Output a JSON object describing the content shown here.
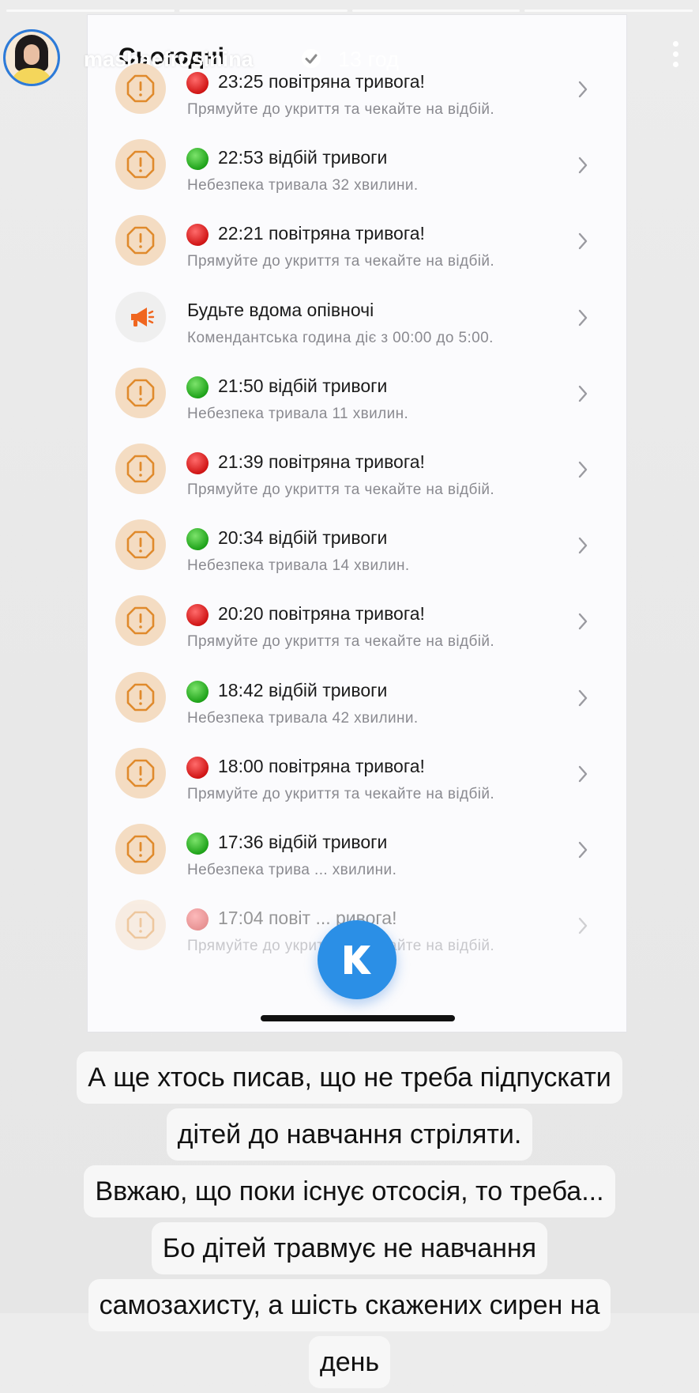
{
  "story": {
    "username": "mashaefrosinina",
    "time_ago": "13 год",
    "verified_icon": "verified-badge-icon",
    "progress_segments": 4
  },
  "screenshot": {
    "section_title": "Сьогодні",
    "items": [
      {
        "dot": "red",
        "title": "23:25 повітряна тривога!",
        "subtitle": "Прямуйте до укриття та чекайте на відбій.",
        "icon": "alert-octagon-icon"
      },
      {
        "dot": "green",
        "title": "22:53 відбій тривоги",
        "subtitle": "Небезпека тривала 32 хвилини.",
        "icon": "alert-octagon-icon"
      },
      {
        "dot": "red",
        "title": "22:21 повітряна тривога!",
        "subtitle": "Прямуйте до укриття та чекайте на відбій.",
        "icon": "alert-octagon-icon"
      },
      {
        "dot": "none",
        "title": "Будьте вдома опівночі",
        "subtitle": "Комендантська година діє з 00:00 до 5:00.",
        "icon": "megaphone-icon"
      },
      {
        "dot": "green",
        "title": "21:50 відбій тривоги",
        "subtitle": "Небезпека тривала 11 хвилин.",
        "icon": "alert-octagon-icon"
      },
      {
        "dot": "red",
        "title": "21:39 повітряна тривога!",
        "subtitle": "Прямуйте до укриття та чекайте на відбій.",
        "icon": "alert-octagon-icon"
      },
      {
        "dot": "green",
        "title": "20:34 відбій тривоги",
        "subtitle": "Небезпека тривала 14 хвилин.",
        "icon": "alert-octagon-icon"
      },
      {
        "dot": "red",
        "title": "20:20 повітряна тривога!",
        "subtitle": "Прямуйте до укриття та чекайте на відбій.",
        "icon": "alert-octagon-icon"
      },
      {
        "dot": "green",
        "title": "18:42 відбій тривоги",
        "subtitle": "Небезпека тривала 42 хвилини.",
        "icon": "alert-octagon-icon"
      },
      {
        "dot": "red",
        "title": "18:00 повітряна тривога!",
        "subtitle": "Прямуйте до укриття та чекайте на відбій.",
        "icon": "alert-octagon-icon"
      },
      {
        "dot": "green",
        "title": "17:36 відбій тривоги",
        "subtitle": "Небезпека трива ... хвилини.",
        "icon": "alert-octagon-icon"
      },
      {
        "dot": "red",
        "title": "17:04 повіт ... ривога!",
        "subtitle": "Прямуйте до укриття та чекайте на відбій.",
        "icon": "alert-octagon-icon"
      }
    ],
    "badge_letter": "K",
    "badge_icon": "kyiv-digital-k-icon"
  },
  "caption": {
    "lines": [
      "А ще хтось писав, що не треба підпускати",
      "дітей до навчання стріляти.",
      "Ввжаю, що поки існує отсосія, то треба...",
      "Бо дітей травмує не навчання",
      "самозахисту, а шість скажених сирен на",
      "день"
    ]
  },
  "colors": {
    "alert_red": "#d01515",
    "clear_green": "#1fa31a",
    "icon_bg": "#f4dcc2",
    "icon_stroke": "#e08a2c",
    "badge_blue": "#2b8fe6"
  }
}
